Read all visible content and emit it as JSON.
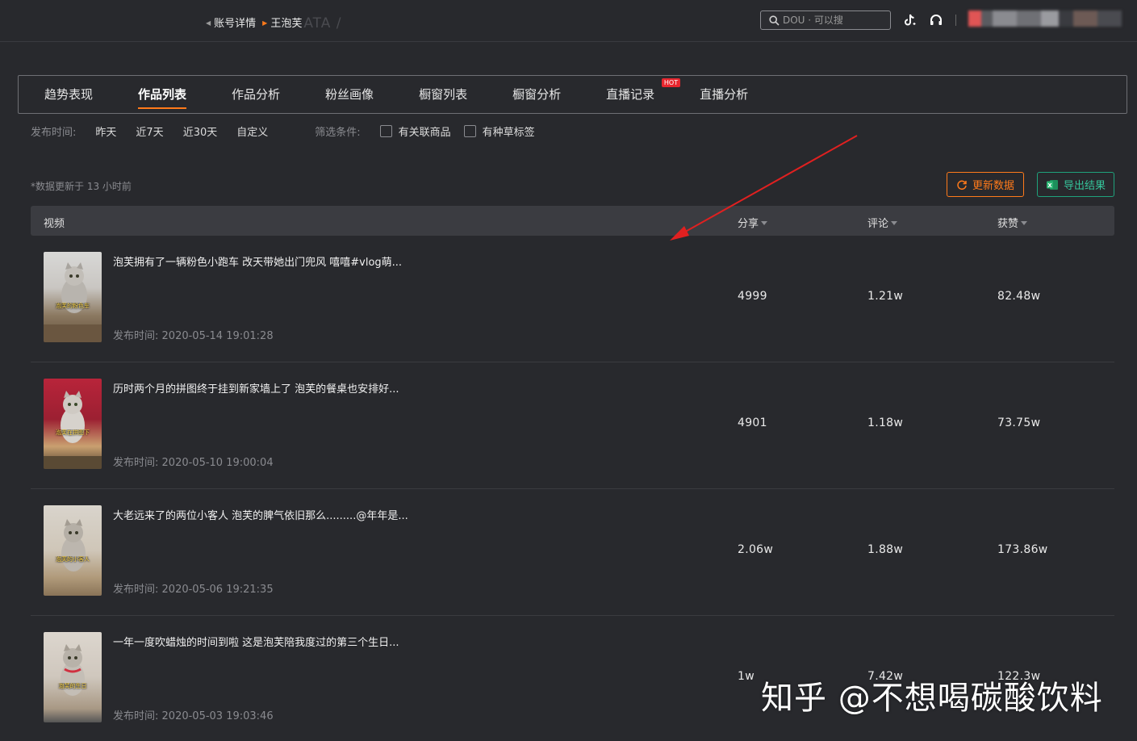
{
  "header": {
    "breadcrumb_parent": "账号详情",
    "breadcrumb_current": "王泡芙",
    "breadcrumb_ghost": "ATA /",
    "search_placeholder": "DOU · 可以搜"
  },
  "tabs": [
    {
      "label": "趋势表现",
      "active": false
    },
    {
      "label": "作品列表",
      "active": true
    },
    {
      "label": "作品分析",
      "active": false
    },
    {
      "label": "粉丝画像",
      "active": false
    },
    {
      "label": "橱窗列表",
      "active": false
    },
    {
      "label": "橱窗分析",
      "active": false
    },
    {
      "label": "直播记录",
      "active": false,
      "badge": "HOT"
    },
    {
      "label": "直播分析",
      "active": false
    }
  ],
  "filters": {
    "time_label": "发布时间:",
    "time_options": [
      "昨天",
      "近7天",
      "近30天",
      "自定义"
    ],
    "condition_label": "筛选条件:",
    "conditions": [
      "有关联商品",
      "有种草标签"
    ]
  },
  "update_notice": "*数据更新于 13 小时前",
  "buttons": {
    "refresh": "更新数据",
    "export": "导出结果"
  },
  "table": {
    "headers": {
      "video": "视频",
      "share": "分享",
      "comment": "评论",
      "likes": "获赞"
    },
    "rows": [
      {
        "title": "泡芙拥有了一辆粉色小跑车 改天带她出门兜风 嘻嘻#vlog萌...",
        "publish_label": "发布时间:",
        "publish_time": "2020-05-14 19:01:28",
        "share": "4999",
        "comment": "1.21w",
        "likes": "82.48w",
        "caption": "泡芙的粉色车"
      },
      {
        "title": "历时两个月的拼图终于挂到新家墙上了 泡芙的餐桌也安排好...",
        "publish_label": "发布时间:",
        "publish_time": "2020-05-10 19:00:04",
        "share": "4901",
        "comment": "1.18w",
        "likes": "73.75w",
        "caption": "泡芙在拼图下"
      },
      {
        "title": "大老远来了的两位小客人 泡芙的脾气依旧那么.........@年年是...",
        "publish_label": "发布时间:",
        "publish_time": "2020-05-06 19:21:35",
        "share": "2.06w",
        "comment": "1.88w",
        "likes": "173.86w",
        "caption": "泡芙的小客人"
      },
      {
        "title": "一年一度吹蜡烛的时间到啦 这是泡芙陪我度过的第三个生日...",
        "publish_label": "发布时间:",
        "publish_time": "2020-05-03 19:03:46",
        "share": "1w",
        "comment": "7.42w",
        "likes": "122.3w",
        "caption": "泡芙的生日"
      }
    ]
  },
  "watermark": "知乎 @不想喝碳酸饮料",
  "icons": {
    "search": "search-icon",
    "tiktok": "tiktok-icon",
    "support": "headset-icon",
    "refresh": "refresh-icon",
    "excel": "excel-icon"
  },
  "colors": {
    "accent": "#ff7a1a",
    "export": "#1fa27c",
    "hot_badge": "#e8262e",
    "annotation": "#e02020"
  }
}
